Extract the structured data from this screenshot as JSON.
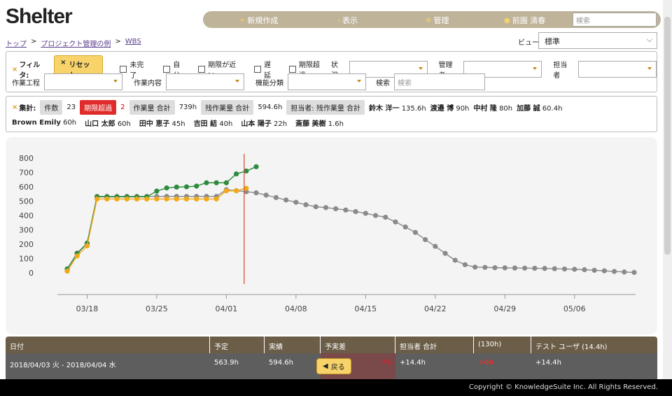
{
  "header": {
    "logo": "Shelter",
    "nav": [
      {
        "label": "新規作成",
        "icon": "plus-icon"
      },
      {
        "label": "表示",
        "icon": "caret-right-icon"
      },
      {
        "label": "管理",
        "icon": "gear-icon"
      },
      {
        "label": "前園 清春",
        "icon": "user-icon"
      }
    ],
    "search_placeholder": "検索"
  },
  "breadcrumb": [
    "トップ",
    "プロジェクト管理の例",
    "WBS"
  ],
  "view": {
    "label": "ビュー",
    "value": "標準"
  },
  "filter": {
    "title": "フィルタ:",
    "reset": "リセット",
    "checkboxes": [
      "未完了",
      "自分",
      "期限が近い",
      "遅延",
      "期限超過"
    ],
    "labels": {
      "status": "状況",
      "manager": "管理者",
      "assignee": "担当者",
      "process": "作業工程",
      "content": "作業内容",
      "category": "機能分類",
      "search": "検索"
    },
    "search_placeholder": "検索"
  },
  "summary": {
    "title": "集計:",
    "count_label": "件数",
    "count": "23",
    "overdue_label": "期限超過",
    "overdue": "2",
    "work_total_label": "作業量 合計",
    "work_total": "739h",
    "remain_total_label": "残作業量 合計",
    "remain_total": "594.6h",
    "by_assignee_label": "担当者: 残作業量 合計",
    "people": [
      {
        "name": "鈴木 洋一",
        "hours": "135.6h"
      },
      {
        "name": "渡邉 博",
        "hours": "90h"
      },
      {
        "name": "中村 隆",
        "hours": "80h"
      },
      {
        "name": "加藤 誠",
        "hours": "60.4h"
      },
      {
        "name": "Brown Emily",
        "hours": "60h"
      },
      {
        "name": "山口 太郎",
        "hours": "60h"
      },
      {
        "name": "田中 恵子",
        "hours": "45h"
      },
      {
        "name": "吉田 結",
        "hours": "40h"
      },
      {
        "name": "山本 陽子",
        "hours": "22h"
      },
      {
        "name": "斎藤 美樹",
        "hours": "1.6h"
      }
    ]
  },
  "chart_data": {
    "type": "line",
    "ylim": [
      0,
      800
    ],
    "yticks": [
      0,
      100,
      200,
      300,
      400,
      500,
      600,
      700,
      800
    ],
    "xticks": [
      {
        "label": "03/18",
        "x": "2018-03-18"
      },
      {
        "label": "03/25",
        "x": "2018-03-25"
      },
      {
        "label": "04/01",
        "x": "2018-04-01"
      },
      {
        "label": "04/08",
        "x": "2018-04-08"
      },
      {
        "label": "04/15",
        "x": "2018-04-15"
      },
      {
        "label": "04/22",
        "x": "2018-04-22"
      },
      {
        "label": "04/29",
        "x": "2018-04-29"
      },
      {
        "label": "05/06",
        "x": "2018-05-06"
      }
    ],
    "today": "2018-04-03",
    "colors": {
      "gray": "#8a8a8a",
      "green": "#2e8b3e",
      "orange": "#f2a918",
      "today": "#d9482b"
    },
    "series": [
      {
        "color_key": "gray",
        "start": "2018-03-16",
        "values": [
          28,
          138,
          208,
          533,
          533,
          533,
          533,
          533,
          533,
          533,
          533,
          533,
          533,
          533,
          533,
          533,
          580,
          573,
          566,
          558,
          542,
          525,
          508,
          492,
          475,
          461,
          455,
          447,
          438,
          427,
          415,
          400,
          388,
          355,
          320,
          282,
          232,
          185,
          136,
          88,
          57,
          40,
          38,
          36,
          35,
          34,
          33,
          32,
          31,
          29,
          27,
          25,
          22,
          18,
          14,
          10,
          6,
          3
        ]
      },
      {
        "color_key": "green",
        "start": "2018-03-16",
        "values": [
          25,
          135,
          205,
          530,
          530,
          530,
          530,
          530,
          530,
          570,
          592,
          598,
          600,
          605,
          628,
          628,
          628,
          690,
          710,
          740
        ]
      },
      {
        "color_key": "orange",
        "start": "2018-03-16",
        "values": [
          12,
          118,
          188,
          515,
          515,
          515,
          515,
          515,
          515,
          515,
          515,
          515,
          515,
          515,
          515,
          515,
          572,
          572,
          590
        ]
      }
    ]
  },
  "table": {
    "headers": [
      "日付",
      "予定",
      "実績",
      "予実差",
      "担当者 合計",
      "(130h)",
      "テスト ユーザ (14.4h)"
    ],
    "row": {
      "date": "2018/04/03 火 - 2018/04/04 水",
      "planned": "563.9h",
      "actual": "594.6h",
      "diff": "7h",
      "assignee_total": "+14.4h",
      "c130": "+0h",
      "test_user": "+14.4h"
    }
  },
  "back_label": "戻る",
  "footer": "Copyright © KnowledgeSuite Inc. All Rights Reserved."
}
